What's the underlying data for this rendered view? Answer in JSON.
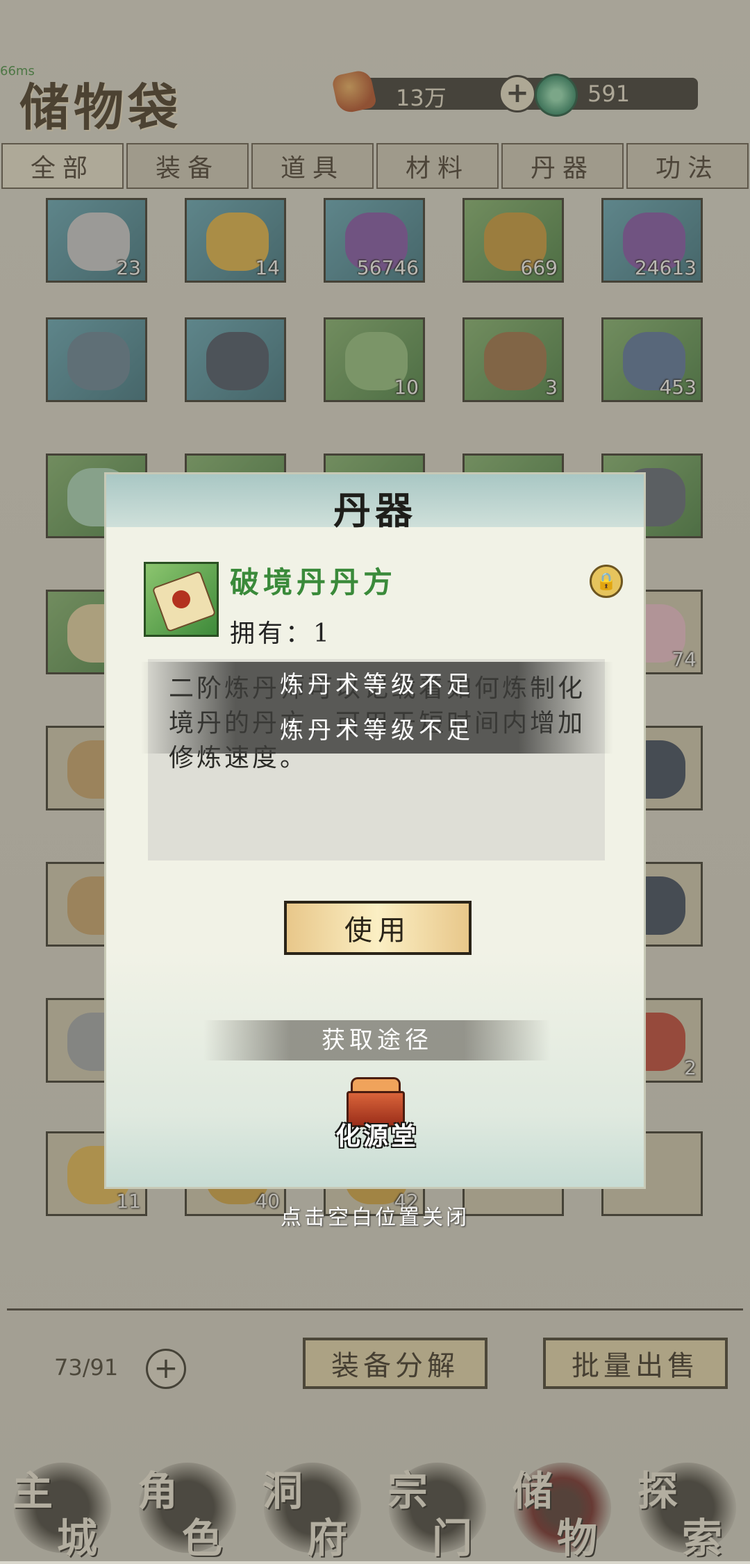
{
  "header": {
    "fps": "66ms",
    "title": "储物袋",
    "spirit_stone_amount": "13万",
    "jade_amount": "591",
    "add_icon": "plus-icon"
  },
  "tabs": [
    {
      "label": "全部",
      "active": true
    },
    {
      "label": "装备",
      "active": false
    },
    {
      "label": "道具",
      "active": false
    },
    {
      "label": "材料",
      "active": false
    },
    {
      "label": "丹器",
      "active": false
    },
    {
      "label": "功法",
      "active": false
    }
  ],
  "grid": {
    "rows": [
      [
        {
          "item": "silver-ingot-icon",
          "count": "23",
          "color": "blue"
        },
        {
          "item": "gold-ore-icon",
          "count": "14",
          "color": "blue"
        },
        {
          "item": "purple-pouch-icon",
          "count": "56746",
          "color": "blue"
        },
        {
          "item": "golden-seal-icon",
          "count": "669",
          "color": "green"
        },
        {
          "item": "purple-pouch-icon",
          "count": "24613",
          "color": "blue"
        }
      ],
      [
        {
          "item": "helmet-icon",
          "count": "",
          "color": "blue"
        },
        {
          "item": "boots-icon",
          "count": "",
          "color": "blue"
        },
        {
          "item": "lily-herb-icon",
          "count": "10",
          "color": "green"
        },
        {
          "item": "bronze-mask-icon",
          "count": "3",
          "color": "green"
        },
        {
          "item": "crystal-ore-icon",
          "count": "453",
          "color": "green"
        }
      ],
      [
        {
          "item": "jade-orb-icon",
          "count": "",
          "color": "green"
        },
        {
          "item": "unknown-icon",
          "count": "",
          "color": "green"
        },
        {
          "item": "unknown-icon",
          "count": "",
          "color": "green"
        },
        {
          "item": "unknown-icon",
          "count": "",
          "color": "green"
        },
        {
          "item": "sword-icon",
          "count": "",
          "color": "green"
        }
      ],
      [
        {
          "item": "scroll-icon",
          "count": "",
          "color": "green"
        },
        {
          "item": "unknown-icon",
          "count": "",
          "color": "tan"
        },
        {
          "item": "unknown-icon",
          "count": "",
          "color": "tan"
        },
        {
          "item": "unknown-icon",
          "count": "",
          "color": "tan"
        },
        {
          "item": "cherry-blossom-icon",
          "count": "74",
          "color": "tan"
        }
      ],
      [
        {
          "item": "rope-icon",
          "count": "",
          "color": "tan"
        },
        {
          "item": "unknown-icon",
          "count": "",
          "color": "tan"
        },
        {
          "item": "unknown-icon",
          "count": "",
          "color": "tan"
        },
        {
          "item": "unknown-icon",
          "count": "",
          "color": "tan"
        },
        {
          "item": "dark-armor-icon",
          "count": "",
          "color": "tan"
        }
      ],
      [
        {
          "item": "rope-icon",
          "count": "",
          "color": "tan"
        },
        {
          "item": "unknown-icon",
          "count": "",
          "color": "tan"
        },
        {
          "item": "unknown-icon",
          "count": "",
          "color": "tan"
        },
        {
          "item": "unknown-icon",
          "count": "",
          "color": "tan"
        },
        {
          "item": "dark-armor-icon",
          "count": "",
          "color": "tan"
        }
      ],
      [
        {
          "item": "stone-beast-icon",
          "count": "",
          "color": "tan"
        },
        {
          "item": "unknown-icon",
          "count": "",
          "color": "tan"
        },
        {
          "item": "unknown-icon",
          "count": "",
          "color": "tan"
        },
        {
          "item": "unknown-icon",
          "count": "",
          "color": "tan"
        },
        {
          "item": "red-pouch-icon",
          "count": "2",
          "color": "tan"
        }
      ],
      [
        {
          "item": "golden-orb-icon",
          "count": "11",
          "color": "tan"
        },
        {
          "item": "gold-item-icon",
          "count": "40",
          "color": "tan"
        },
        {
          "item": "gold-item-icon",
          "count": "42",
          "color": "tan"
        },
        {
          "item": "empty-slot",
          "count": "",
          "color": "tan"
        },
        {
          "item": "empty-slot",
          "count": "",
          "color": "tan"
        }
      ]
    ]
  },
  "footer": {
    "capacity": "73/91",
    "disassemble_label": "装备分解",
    "bulk_sell_label": "批量出售"
  },
  "nav": [
    {
      "c1": "主",
      "c2": "城",
      "active": false
    },
    {
      "c1": "角",
      "c2": "色",
      "active": false
    },
    {
      "c1": "洞",
      "c2": "府",
      "active": false
    },
    {
      "c1": "宗",
      "c2": "门",
      "active": false
    },
    {
      "c1": "储",
      "c2": "物",
      "active": true
    },
    {
      "c1": "探",
      "c2": "索",
      "active": false
    }
  ],
  "modal": {
    "title": "丹器",
    "item_name": "破境丹丹方",
    "own_text": "拥有：1",
    "description": "二阶炼丹师可以记载着如何炼制化境丹的丹方，可用于短时间内增加修炼速度。",
    "toast1": "炼丹术等级不足",
    "toast2": "炼丹术等级不足",
    "use_label": "使用",
    "source_title": "获取途径",
    "source_name": "化源堂",
    "close_hint": "点击空白位置关闭"
  }
}
